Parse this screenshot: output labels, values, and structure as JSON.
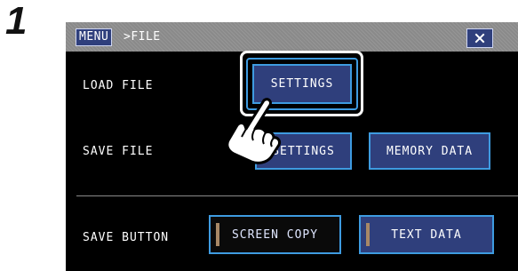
{
  "step": {
    "number": "1"
  },
  "titlebar": {
    "menu_label": "MENU",
    "path_label": ">FILE",
    "close_icon": "close-icon",
    "close_glyph": "×"
  },
  "rows": {
    "load_file": {
      "label": "LOAD FILE",
      "settings_label": "SETTINGS"
    },
    "save_file": {
      "label": "SAVE FILE",
      "settings_label": "SETTINGS",
      "memory_data_label": "MEMORY DATA"
    },
    "save_button": {
      "label": "SAVE BUTTON",
      "screen_copy_label": "SCREEN COPY",
      "text_data_label": "TEXT DATA",
      "selected": "SCREEN COPY"
    }
  },
  "overlay": {
    "pointer_icon": "pointing-hand-icon"
  },
  "colors": {
    "screen_bg": "#000000",
    "titlebar_bg": "#8a8a8a",
    "button_bg": "#2f3f7c",
    "button_border": "#3e9be0",
    "highlight_frame": "#ffffff",
    "indicator": "#a88866"
  }
}
